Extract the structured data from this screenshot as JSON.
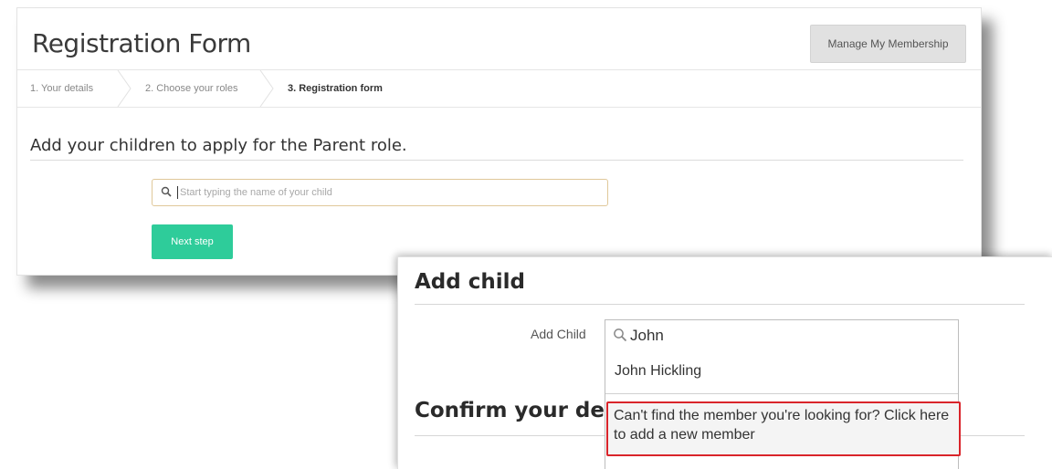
{
  "top": {
    "title": "Registration Form",
    "manage_button": "Manage My Membership",
    "steps": [
      "1. Your details",
      "2. Choose your roles",
      "3. Registration form"
    ],
    "section_heading": "Add your children to apply for the Parent role.",
    "search_placeholder": "Start typing the name of your child",
    "next_button": "Next step",
    "colors": {
      "primary": "#2ecc9a",
      "manage_bg": "#e1e1e1"
    }
  },
  "bottom": {
    "heading": "Add child",
    "field_label": "Add Child",
    "field_value": "John",
    "results": [
      "John Hickling"
    ],
    "add_new_text": "Can't find the member you're looking for? Click here to add a new member",
    "confirm_heading": "Confirm your det",
    "colors": {
      "highlight_border": "#d9242a"
    }
  }
}
